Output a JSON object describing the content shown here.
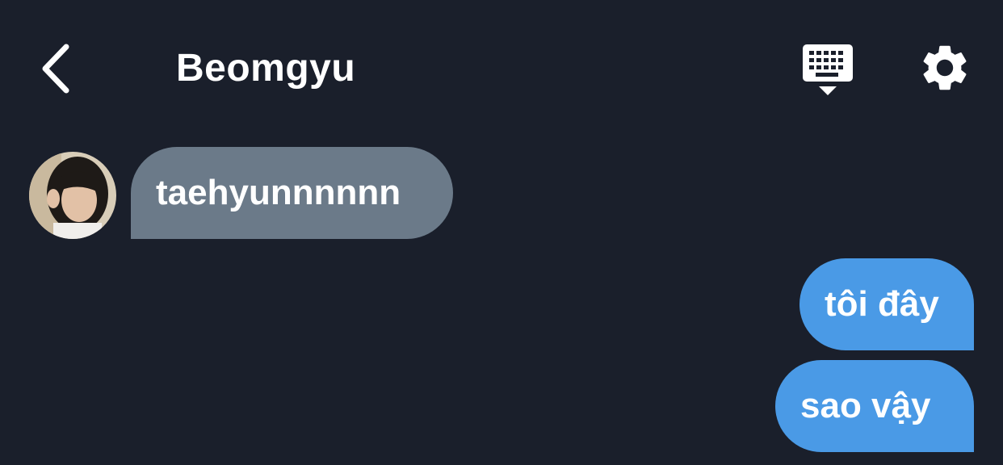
{
  "header": {
    "title": "Beomgyu",
    "back_icon": "chevron-left-icon",
    "keyboard_icon": "keyboard-icon",
    "settings_icon": "gear-icon"
  },
  "messages": [
    {
      "direction": "incoming",
      "text": "taehyunnnnnn",
      "color": "#6b7a89"
    },
    {
      "direction": "outgoing",
      "text": "tôi đây",
      "color": "#4a9ae6"
    },
    {
      "direction": "outgoing",
      "text": "sao vậy",
      "color": "#4a9ae6"
    }
  ],
  "colors": {
    "background": "#1a1f2b",
    "incoming_bubble": "#6b7a89",
    "outgoing_bubble": "#4a9ae6",
    "text": "#ffffff"
  }
}
